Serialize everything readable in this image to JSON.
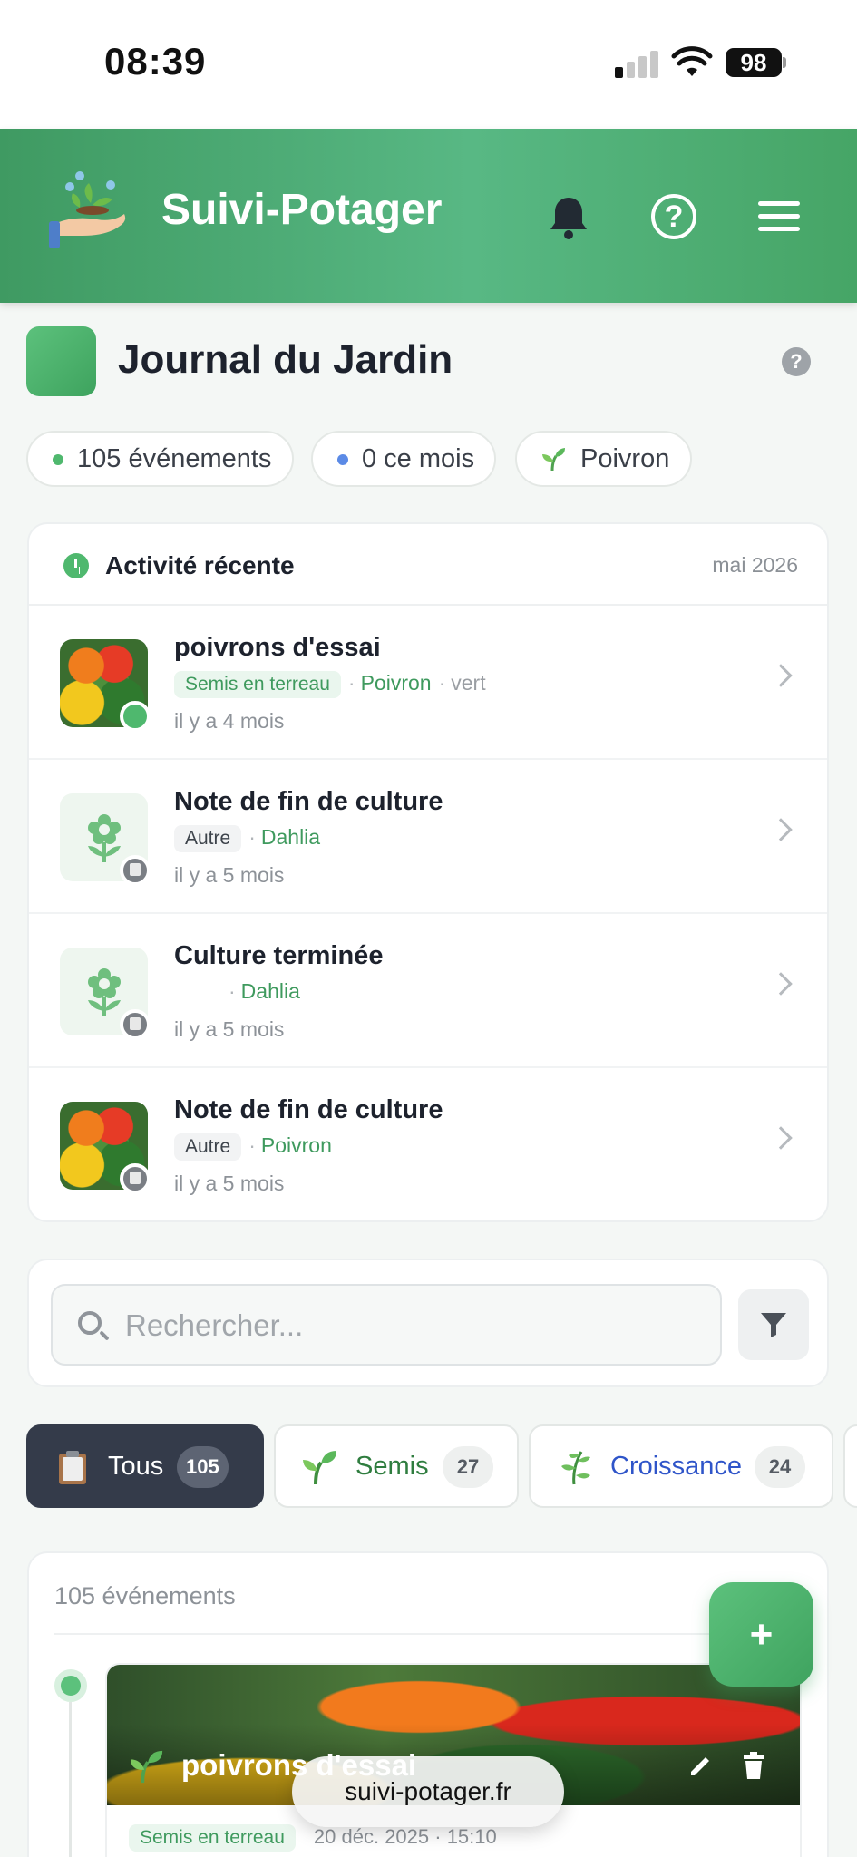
{
  "status_bar": {
    "time": "08:39",
    "battery": "98"
  },
  "app_bar": {
    "title": "Suivi-Potager"
  },
  "journal": {
    "title": "Journal du Jardin",
    "help": "?"
  },
  "chips": [
    {
      "label": "105 événements",
      "dot_color": "#4fb86e"
    },
    {
      "label": "0 ce mois",
      "dot_color": "#5b8ae6"
    },
    {
      "label": "Poivron",
      "icon": "sprout-icon"
    }
  ],
  "recent": {
    "title": "Activité récente",
    "date": "mai 2026",
    "items": [
      {
        "title": "poivrons d'essai",
        "tag": "Semis en terreau",
        "plant": "Poivron",
        "variety": "vert",
        "time": "il y a 4 mois",
        "thumb": "peppers-photo",
        "badge": "green-dot"
      },
      {
        "title": "Note de fin de culture",
        "tag": "Autre",
        "plant": "Dahlia",
        "variety": "",
        "time": "il y a 5 mois",
        "thumb": "flower-icon",
        "badge": "clipboard-icon"
      },
      {
        "title": "Culture terminée",
        "tag": "",
        "plant": "Dahlia",
        "variety": "",
        "time": "il y a 5 mois",
        "thumb": "flower-icon",
        "badge": "clipboard-icon"
      },
      {
        "title": "Note de fin de culture",
        "tag": "Autre",
        "plant": "Poivron",
        "variety": "",
        "time": "il y a 5 mois",
        "thumb": "peppers-photo",
        "badge": "clipboard-icon"
      }
    ]
  },
  "search": {
    "placeholder": "Rechercher..."
  },
  "filter_tabs": [
    {
      "label": "Tous",
      "count": "105",
      "icon": "clipboard-icon",
      "active": true
    },
    {
      "label": "Semis",
      "count": "27",
      "icon": "sprout-icon",
      "active": false
    },
    {
      "label": "Croissance",
      "count": "24",
      "icon": "herb-icon",
      "active": false
    }
  ],
  "events": {
    "count_label": "105 événements",
    "first": {
      "title": "poivrons d'essai",
      "tag": "Semis en terreau",
      "date": "20 déc. 2025 · 15:10"
    }
  },
  "fab": {
    "label": "+"
  },
  "url_bar": {
    "url": "suivi-potager.fr"
  },
  "colors": {
    "brand_green": "#4fb86e",
    "dark_tab": "#343b4a",
    "link_blue": "#2f55c9"
  }
}
